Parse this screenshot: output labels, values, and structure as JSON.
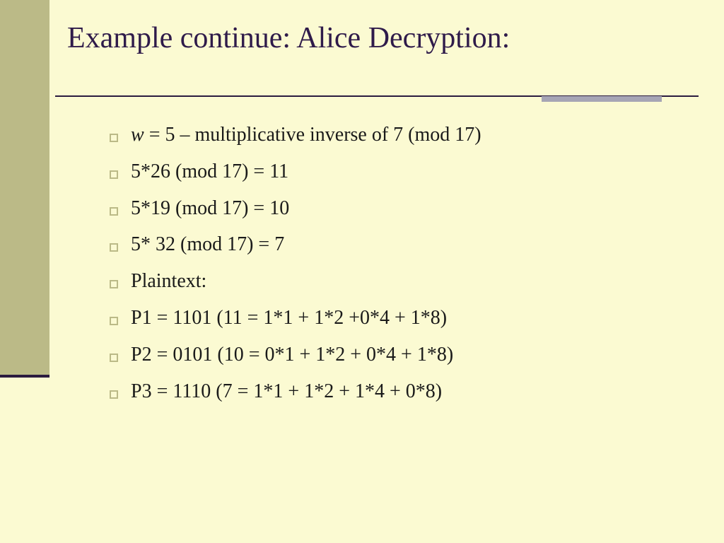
{
  "title": "Example continue: Alice Decryption:",
  "bullets": [
    {
      "prefix": "w",
      "rest": " = 5 – multiplicative inverse of 7 (mod 17)"
    },
    {
      "prefix": "",
      "rest": "5*26 (mod 17) = 11"
    },
    {
      "prefix": "",
      "rest": "5*19 (mod 17) = 10"
    },
    {
      "prefix": "",
      "rest": "5* 32 (mod 17) = 7"
    },
    {
      "prefix": "",
      "rest": "Plaintext:"
    },
    {
      "prefix": "",
      "rest": "P1 = 1101 (11 = 1*1 + 1*2 +0*4 + 1*8)"
    },
    {
      "prefix": "",
      "rest": "P2 = 0101 (10 = 0*1 + 1*2 + 0*4 + 1*8)"
    },
    {
      "prefix": "",
      "rest": "P3 =  1110 (7 = 1*1 + 1*2 + 1*4 + 0*8)"
    }
  ]
}
